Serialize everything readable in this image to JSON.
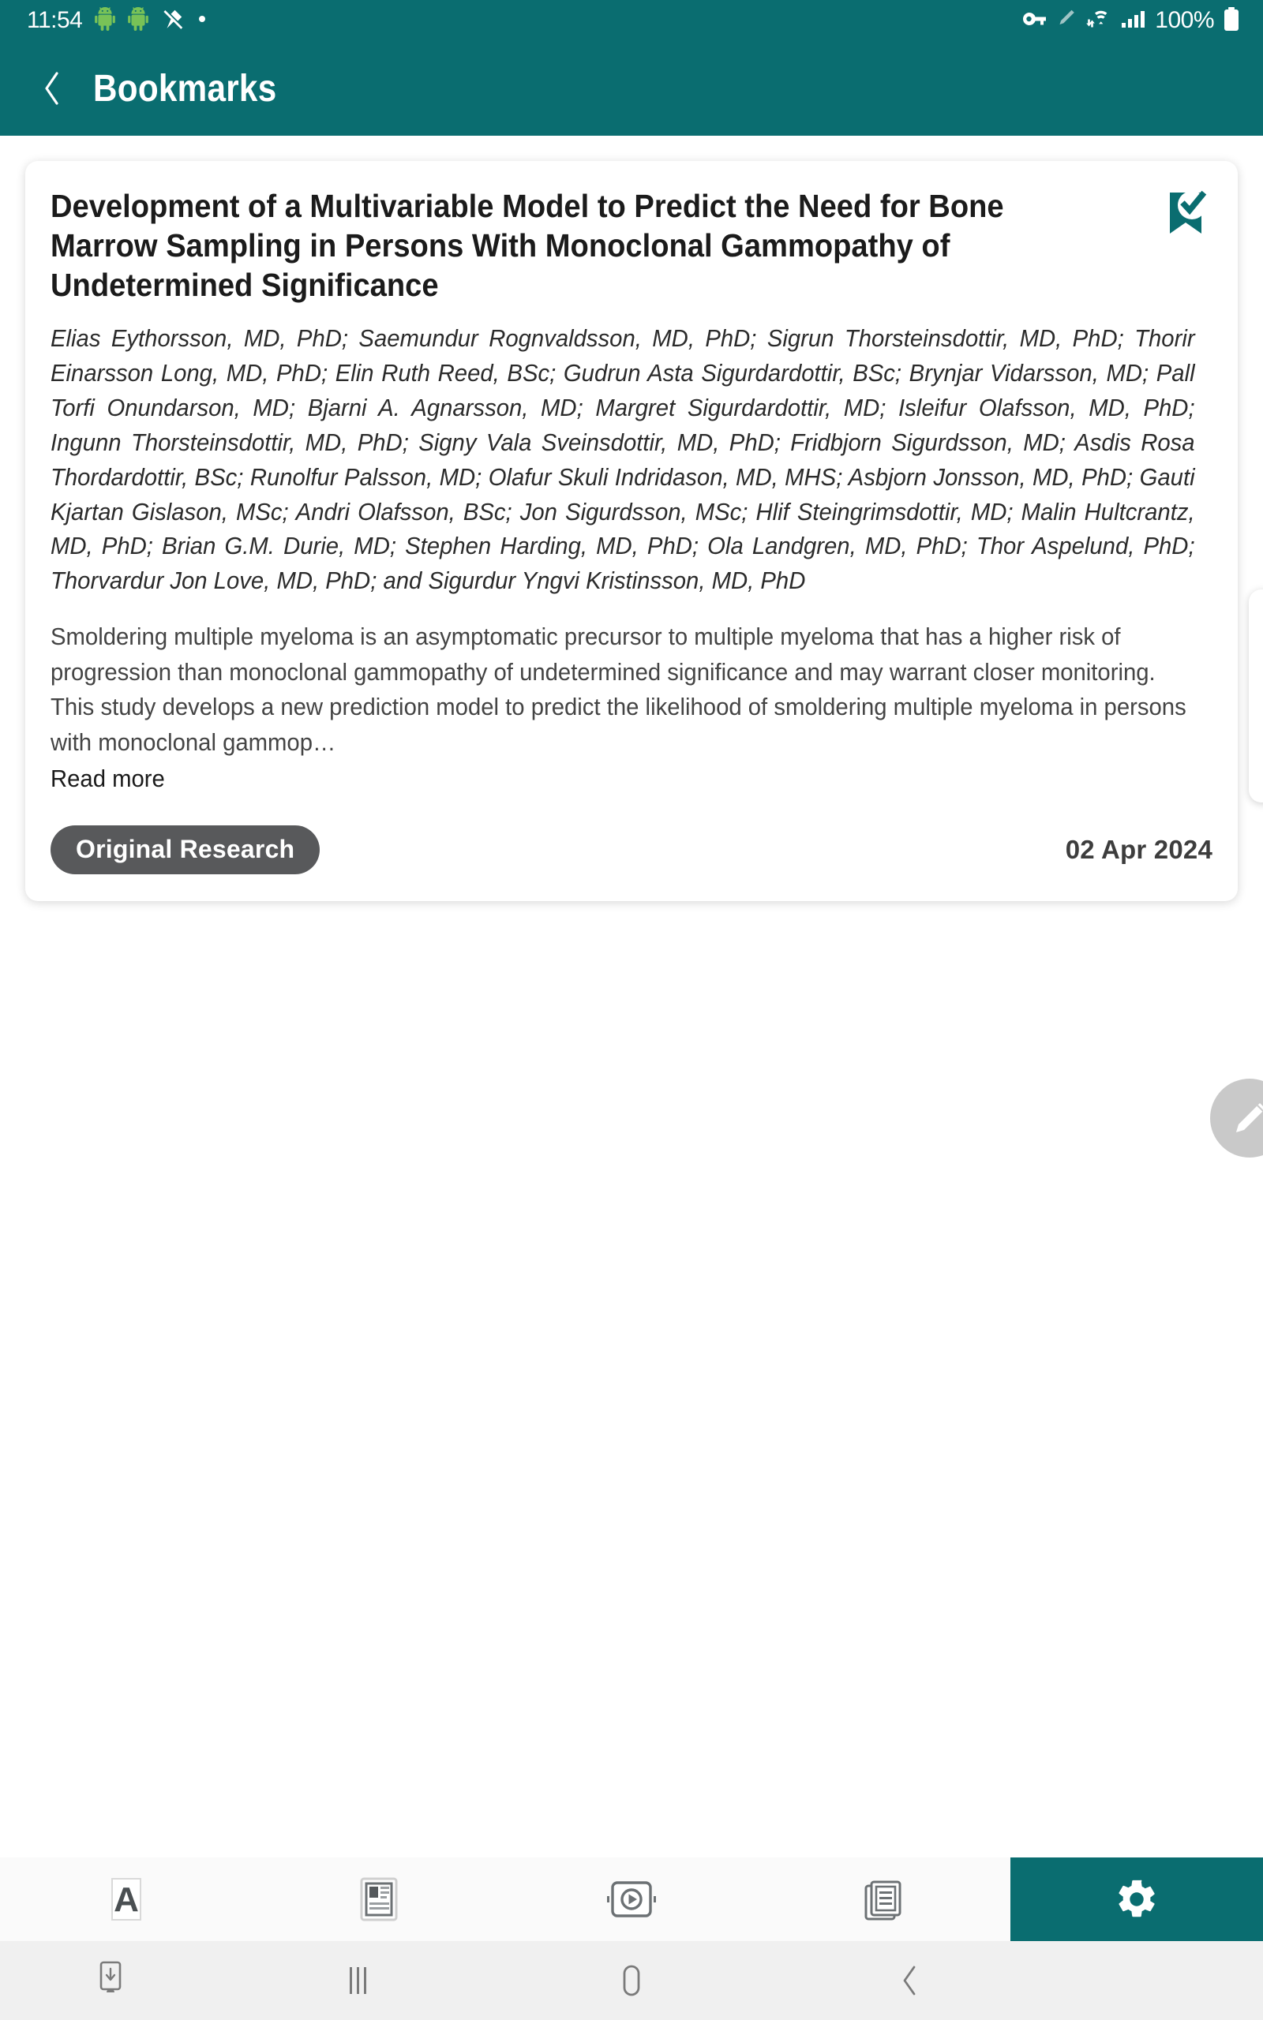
{
  "status_bar": {
    "clock": "11:54",
    "battery_percent": "100%",
    "icons": [
      "android-icon",
      "android-icon",
      "no-location-icon",
      "dot-icon",
      "vpn-key-icon",
      "pencil-icon",
      "wifi-icon",
      "cellular-signal-icon",
      "battery-icon"
    ]
  },
  "app_bar": {
    "back_label": "‹",
    "title": "Bookmarks"
  },
  "colors": {
    "brand_teal": "#0a6d70",
    "badge_gray": "#58595b",
    "fab_gray": "#c9c9c9",
    "page_bg": "#ffffff"
  },
  "article": {
    "title": "Development of a Multivariable Model to Predict the Need for Bone Marrow Sampling in Persons With Monoclonal Gammopathy of Undetermined Significance",
    "authors": "Elias Eythorsson, MD, PhD; Saemundur Rognvaldsson, MD, PhD; Sigrun Thorsteinsdottir, MD, PhD; Thorir Einarsson Long, MD, PhD; Elin Ruth Reed, BSc; Gudrun Asta Sigurdardottir, BSc; Brynjar Vidarsson, MD; Pall Torfi Onundarson, MD; Bjarni A. Agnarsson, MD; Margret Sigurdardottir, MD; Isleifur Olafsson, MD, PhD; Ingunn Thorsteinsdottir, MD, PhD; Signy Vala Sveinsdottir, MD, PhD; Fridbjorn Sigurdsson, MD; Asdis Rosa Thordardottir, BSc; Runolfur Palsson, MD; Olafur Skuli Indridason, MD, MHS; Asbjorn Jonsson, MD, PhD; Gauti Kjartan Gislason, MSc; Andri Olafsson, BSc; Jon Sigurdsson, MSc; Hlif Steingrimsdottir, MD; Malin Hultcrantz, MD, PhD; Brian G.M. Durie, MD; Stephen Harding, MD, PhD; Ola Landgren, MD, PhD; Thor Aspelund, PhD; Thorvardur Jon Love, MD, PhD; and Sigurdur Yngvi Kristinsson, MD, PhD",
    "abstract": "Smoldering multiple myeloma is an asymptomatic precursor to multiple myeloma that has a higher risk of progression than monoclonal gammopathy of undetermined significance and may warrant closer monitoring. This study develops a new prediction model to predict the likelihood of smoldering multiple myeloma in persons with monoclonal gammop…",
    "read_more_label": "Read more",
    "badge_label": "Original Research",
    "date": "02 Apr 2024",
    "bookmark_icon": "bookmark-check-icon",
    "bookmarked": true
  },
  "fab": {
    "icon": "pencil-edit-icon"
  },
  "tab_bar": {
    "tabs": [
      {
        "name": "tab-articles",
        "icon": "letter-a-icon",
        "active": false
      },
      {
        "name": "tab-news",
        "icon": "article-layout-icon",
        "active": false
      },
      {
        "name": "tab-video",
        "icon": "video-play-icon",
        "active": false
      },
      {
        "name": "tab-issues",
        "icon": "stacked-pages-icon",
        "active": false
      },
      {
        "name": "tab-settings",
        "icon": "gear-icon",
        "active": true
      }
    ]
  },
  "system_nav": {
    "buttons": [
      {
        "name": "nav-screenshot",
        "icon": "screenshot-icon"
      },
      {
        "name": "nav-recents",
        "icon": "recents-icon"
      },
      {
        "name": "nav-home",
        "icon": "home-pill-icon"
      },
      {
        "name": "nav-back",
        "icon": "back-chevron-icon"
      }
    ]
  }
}
